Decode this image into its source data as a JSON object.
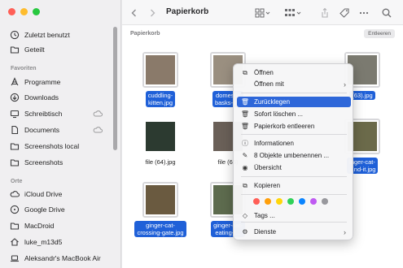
{
  "sidebar": {
    "items_top": [
      {
        "label": "Zuletzt benutzt",
        "icon": "clock-icon"
      },
      {
        "label": "Geteilt",
        "icon": "shared-folder-icon"
      }
    ],
    "favorites_title": "Favoriten",
    "favorites": [
      {
        "label": "Programme",
        "icon": "apps-icon"
      },
      {
        "label": "Downloads",
        "icon": "download-icon"
      },
      {
        "label": "Schreibtisch",
        "icon": "desktop-icon"
      },
      {
        "label": "Documents",
        "icon": "document-icon"
      },
      {
        "label": "Screenshots local",
        "icon": "folder-icon"
      },
      {
        "label": "Screenshots",
        "icon": "folder-icon"
      }
    ],
    "places_title": "Orte",
    "places": [
      {
        "label": "iCloud Drive",
        "icon": "cloud-icon"
      },
      {
        "label": "Google Drive",
        "icon": "drive-icon"
      },
      {
        "label": "MacDroid",
        "icon": "folder-icon"
      },
      {
        "label": "luke_m13d5",
        "icon": "home-icon"
      },
      {
        "label": "Aleksandr's MacBook Air",
        "icon": "laptop-icon"
      }
    ]
  },
  "toolbar": {
    "title": "Papierkorb"
  },
  "pathbar": {
    "label": "Papierkorb",
    "empty_button": "Entleeren"
  },
  "files": [
    {
      "name": "cuddling-kitten.jpg",
      "lines": [
        "cuddling-",
        "kitten.jpg"
      ],
      "selected": true,
      "color": "#8a7a6a"
    },
    {
      "name": "domestic-basks-s...",
      "lines": [
        "domestic",
        "basks-s..."
      ],
      "selected": true,
      "color": "#9a8f80"
    },
    {
      "name": "(63).jpg",
      "lines": [
        "(63).jpg"
      ],
      "selected": true,
      "color": "#7b7a70"
    },
    {
      "name": "file (64).jpg",
      "lines": [
        "file (64).jpg"
      ],
      "selected": false,
      "color": "#2c3a30"
    },
    {
      "name": "file (65)",
      "lines": [
        "file (65)"
      ],
      "selected": false,
      "color": "#6a6058"
    },
    {
      "name": "ginger-cat-...nd-it.jpg",
      "lines": [
        "inger-cat-",
        "...nd-it.jpg"
      ],
      "selected": true,
      "color": "#6b6a4a"
    },
    {
      "name": "ginger-cat-crossing-gate.jpg",
      "lines": [
        "ginger-cat-",
        "crossing-gate.jpg"
      ],
      "selected": true,
      "color": "#6a5a40"
    },
    {
      "name": "ginger-cat-eating-f...",
      "lines": [
        "ginger-cat-",
        "eating-f..."
      ],
      "selected": true,
      "color": "#5d6b4e"
    }
  ],
  "context_menu": {
    "open": "Öffnen",
    "open_with": "Öffnen mit",
    "restore": "Zurücklegen",
    "delete_now": "Sofort löschen ...",
    "empty_trash": "Papierkorb entleeren",
    "info": "Informationen",
    "rename": "8 Objekte umbenennen ...",
    "overview": "Übersicht",
    "copy": "Kopieren",
    "tags": "Tags ...",
    "services": "Dienste",
    "tag_colors": [
      "#ff5e57",
      "#ff9f0a",
      "#ffd60a",
      "#30d158",
      "#0a84ff",
      "#bf5af2",
      "#98989d"
    ]
  }
}
